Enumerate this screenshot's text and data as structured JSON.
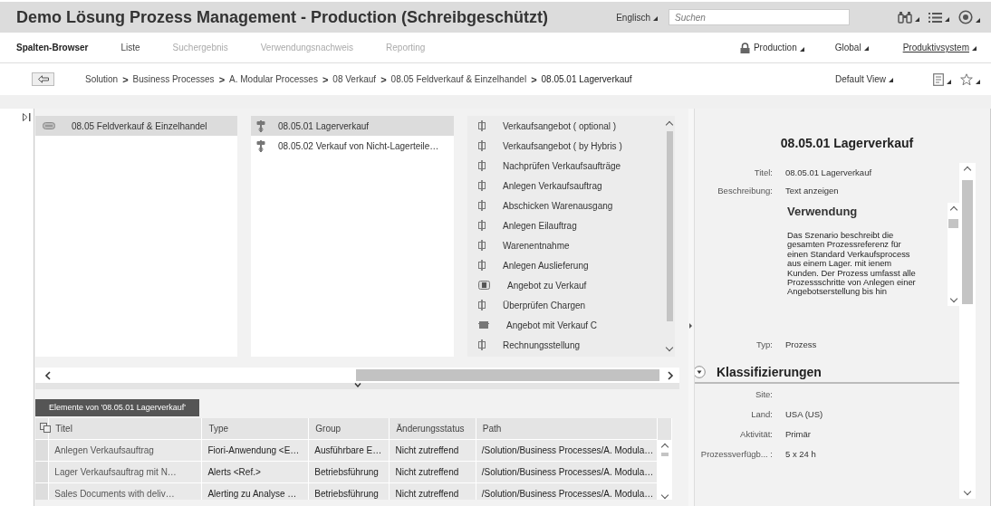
{
  "window": {
    "title": "Demo Lösung Prozess Management - Production (Schreibgeschützt)"
  },
  "header": {
    "language": "Englisch",
    "search": {
      "placeholder": "Suchen"
    }
  },
  "tabs": [
    {
      "label": "Spalten-Browser",
      "selected": true,
      "disabled": false
    },
    {
      "label": "Liste",
      "selected": false,
      "disabled": false
    },
    {
      "label": "Suchergebnis",
      "selected": false,
      "disabled": true
    },
    {
      "label": "Verwendungsnachweis",
      "selected": false,
      "disabled": true
    },
    {
      "label": "Reporting",
      "selected": false,
      "disabled": true
    }
  ],
  "context": [
    {
      "label": "Production",
      "kind": "lock"
    },
    {
      "label": "Global",
      "kind": "menu"
    },
    {
      "label": "Produktivsystem",
      "kind": "link"
    }
  ],
  "breadcrumb": {
    "separator": ">",
    "items": [
      "Solution",
      "Business Processes",
      "A. Modular Processes",
      "08 Verkauf",
      "08.05 Feldverkauf & Einzelhandel",
      "08.05.01 Lagerverkauf"
    ]
  },
  "view": "Default View",
  "columns": [
    {
      "items": [
        {
          "label": "08.05 Feldverkauf & Einzelhandel",
          "kind": "folder",
          "selected": true
        }
      ]
    },
    {
      "items": [
        {
          "label": "08.05.01 Lagerverkauf",
          "kind": "process",
          "selected": true
        },
        {
          "label": "08.05.02 Verkauf von Nicht-Lagerteile…",
          "kind": "process",
          "selected": false
        }
      ]
    },
    {
      "items": [
        {
          "label": "Verkaufsangebot ( optional )",
          "kind": "step",
          "selected": false
        },
        {
          "label": "Verkaufsangebot ( by Hybris )",
          "kind": "step",
          "selected": false
        },
        {
          "label": "Nachprüfen Verkaufsaufträge",
          "kind": "step",
          "selected": false
        },
        {
          "label": "Anlegen Verkaufsauftrag",
          "kind": "step",
          "selected": false
        },
        {
          "label": "Abschicken Warenausgang",
          "kind": "step",
          "selected": false
        },
        {
          "label": "Anlegen Eilauftrag",
          "kind": "step",
          "selected": false
        },
        {
          "label": "Warenentnahme",
          "kind": "step",
          "selected": false
        },
        {
          "label": "Anlegen Auslieferung",
          "kind": "step",
          "selected": false
        },
        {
          "label": "Angebot zu Verkauf",
          "kind": "scenario",
          "selected": false
        },
        {
          "label": "Überprüfen Chargen",
          "kind": "step",
          "selected": false
        },
        {
          "label": "Angebot mit Verkauf C",
          "kind": "block",
          "selected": false
        },
        {
          "label": "Rechnungsstellung",
          "kind": "step",
          "selected": false
        }
      ]
    }
  ],
  "elements_tab": "Elemente von '08.05.01 Lagerverkauf'",
  "table": {
    "columns": [
      "Titel",
      "Type",
      "Group",
      "Änderungsstatus",
      "Path"
    ],
    "rows": [
      [
        "Anlegen Verkaufsauftrag",
        "Fiori-Anwendung <E…",
        "Ausführbare E…",
        "Nicht zutreffend",
        "/Solution/Business Processes/A. Modula…"
      ],
      [
        "Lager Verkaufsauftrag mit N…",
        "Alerts <Ref.>",
        "Betriebsführung",
        "Nicht zutreffend",
        "/Solution/Business Processes/A. Modula…"
      ],
      [
        "Sales Documents with deliv…",
        "Alerting zu Analyse …",
        "Betriebsführung",
        "Nicht zutreffend",
        "/Solution/Business Processes/A. Modula…"
      ]
    ]
  },
  "detail": {
    "title": "08.05.01 Lagerverkauf",
    "fields": [
      {
        "label": "Titel:",
        "value": "08.05.01 Lagerverkauf"
      },
      {
        "label": "Beschreibung:",
        "value": "Text anzeigen"
      }
    ],
    "description": {
      "heading": "Verwendung",
      "text": "Das Szenario beschreibt die gesamten Prozessreferenz für einen Standard Verkaufsprocess aus einem Lager. mit ienem Kunden. Der Prozess umfasst alle Prozessschritte von Anlegen einer Angebotserstellung bis hin"
    },
    "type": {
      "label": "Typ:",
      "value": "Prozess"
    }
  },
  "classification": {
    "title": "Klassifizierungen",
    "expanded": true,
    "fields": [
      {
        "label": "Site:"
      },
      {
        "label": "Land:",
        "value": "USA (US)"
      },
      {
        "label": "Aktivität:",
        "value": "Primär"
      },
      {
        "label": "Prozessverfügb... :",
        "value": "5 x 24 h"
      }
    ]
  }
}
